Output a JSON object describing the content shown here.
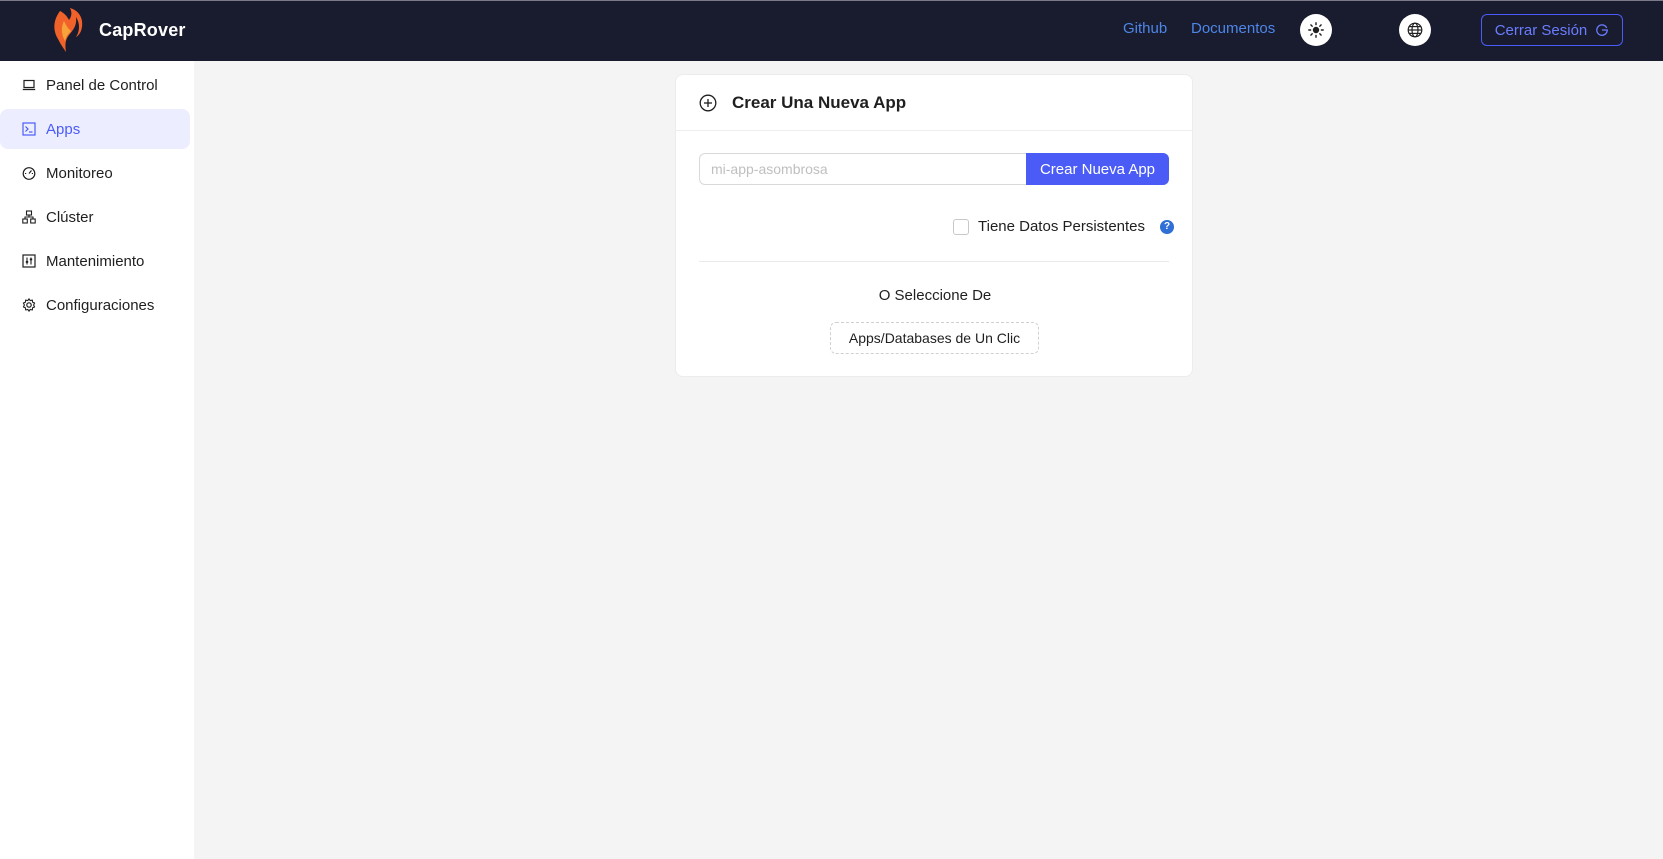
{
  "app": {
    "name": "CapRover"
  },
  "header": {
    "links": [
      {
        "label": "Github"
      },
      {
        "label": "Documentos"
      }
    ],
    "theme_icon": "sun-icon",
    "language_icon": "globe-icon",
    "logout_label": "Cerrar Sesión"
  },
  "sidebar": {
    "items": [
      {
        "label": "Panel de Control",
        "icon": "laptop-icon",
        "active": false
      },
      {
        "label": "Apps",
        "icon": "code-icon",
        "active": true
      },
      {
        "label": "Monitoreo",
        "icon": "dashboard-icon",
        "active": false
      },
      {
        "label": "Clúster",
        "icon": "cluster-icon",
        "active": false
      },
      {
        "label": "Mantenimiento",
        "icon": "control-icon",
        "active": false
      },
      {
        "label": "Configuraciones",
        "icon": "gear-icon",
        "active": false
      }
    ]
  },
  "create_card": {
    "title": "Crear Una Nueva App",
    "input_placeholder": "mi-app-asombrosa",
    "input_value": "",
    "create_button": "Crear Nueva App",
    "persistent_label": "Tiene Datos Persistentes",
    "persistent_checked": false,
    "or_text": "O Seleccione De",
    "oneclick_button": "Apps/Databases de Un Clic"
  },
  "colors": {
    "topbar": "#191b2e",
    "accent": "#4b5cf6",
    "link": "#4d86e8"
  }
}
